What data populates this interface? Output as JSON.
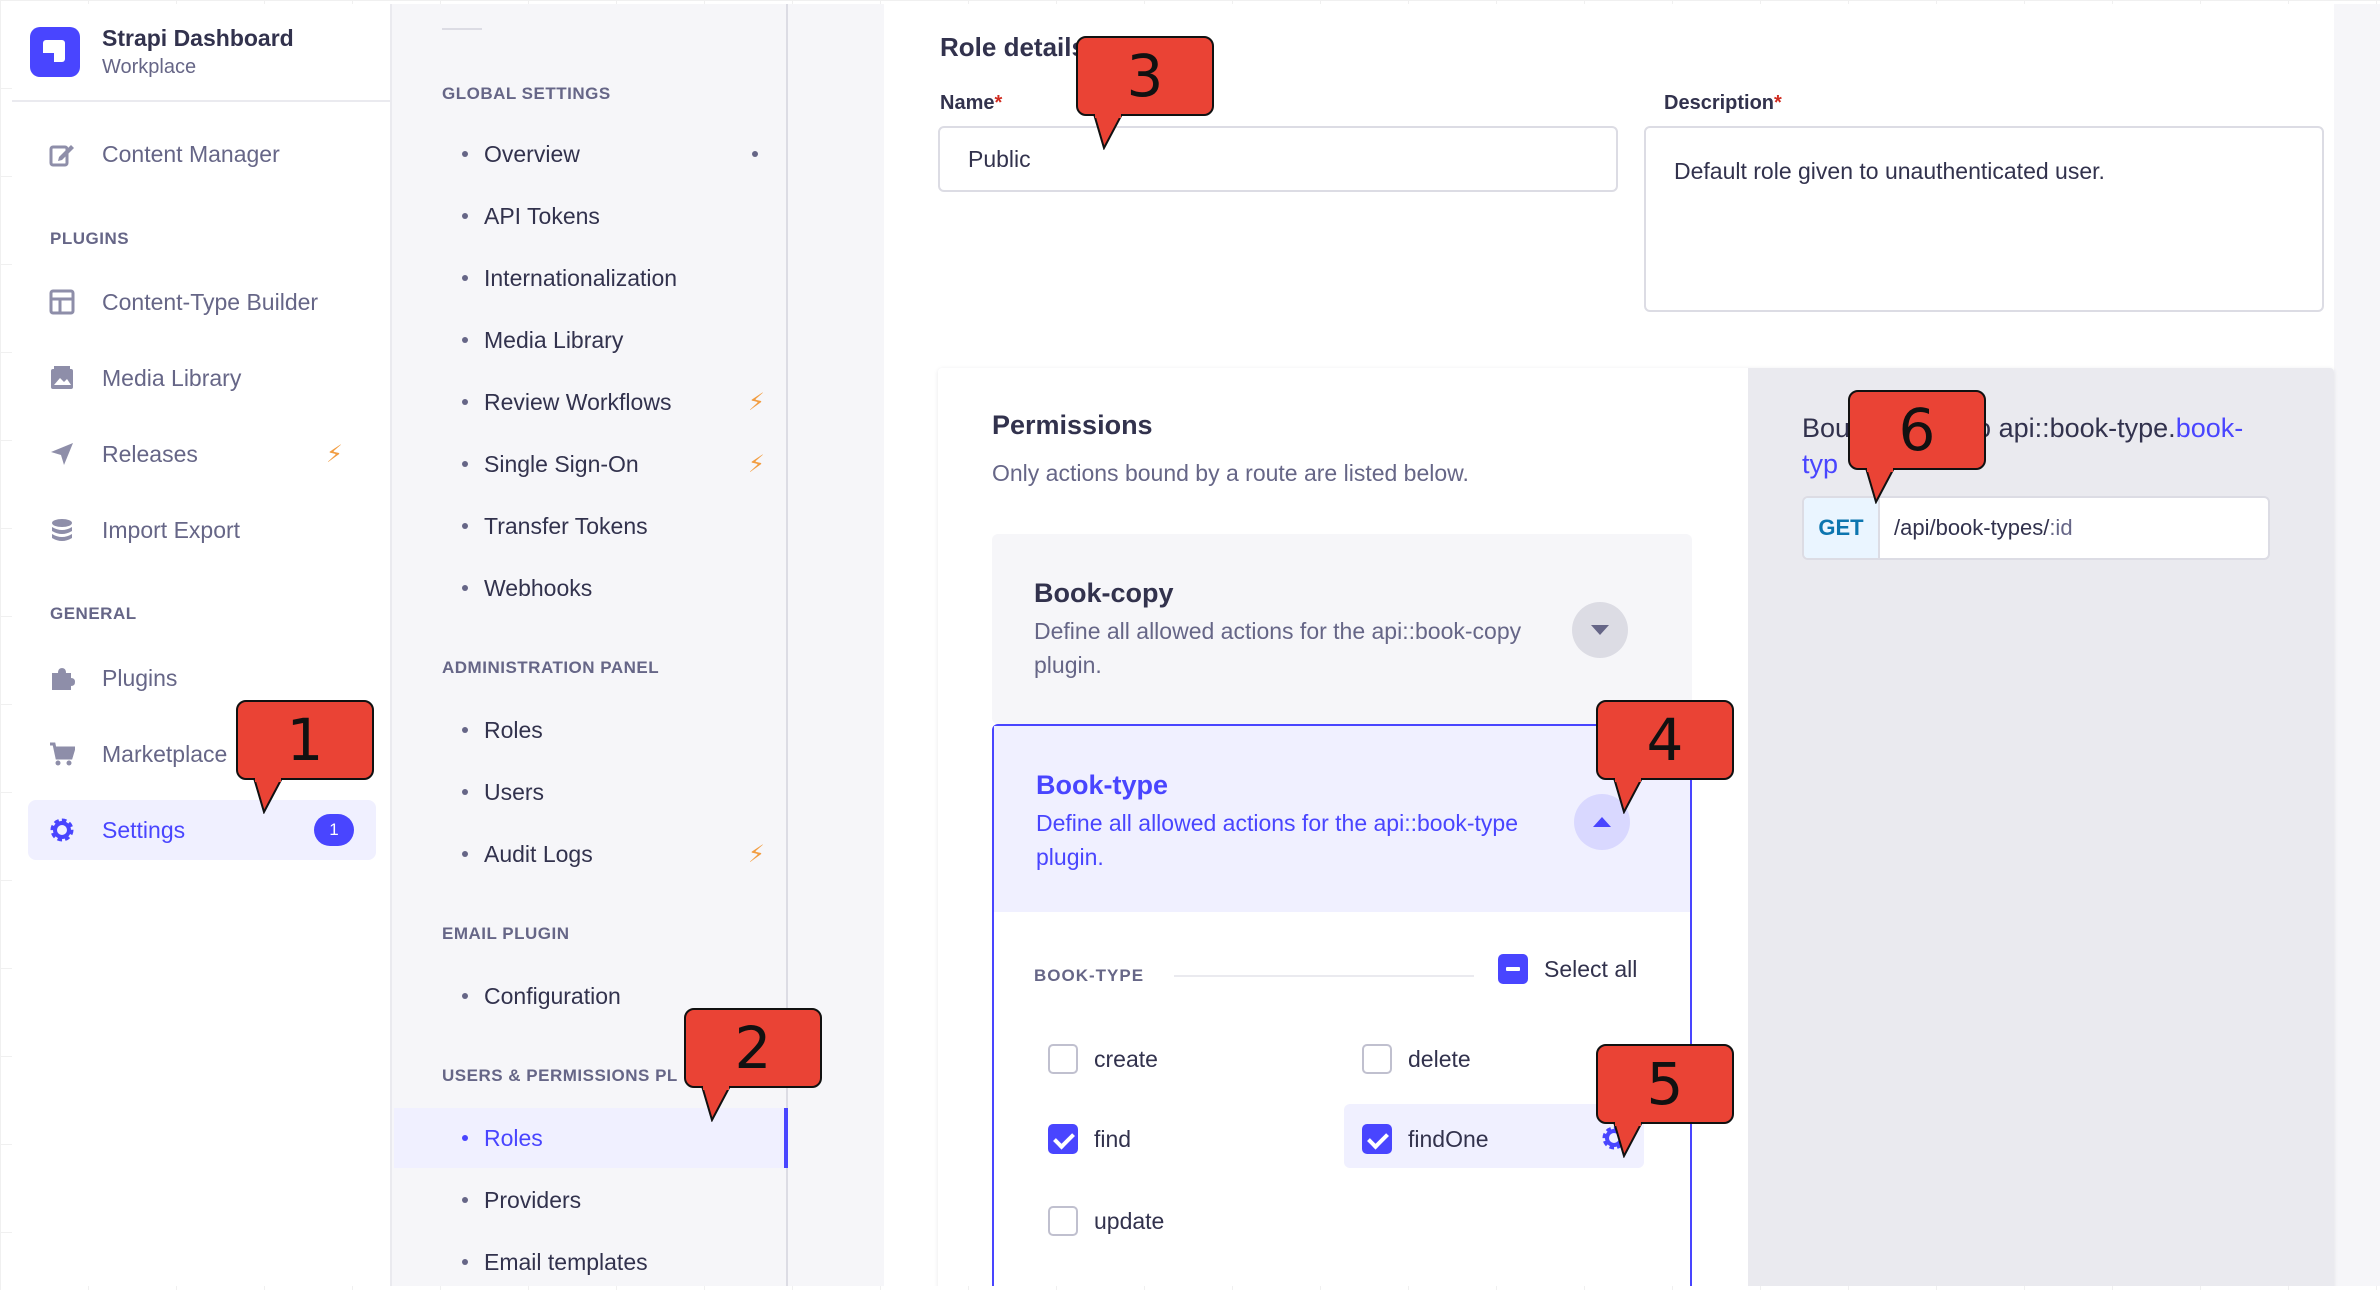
{
  "brand": {
    "title": "Strapi Dashboard",
    "subtitle": "Workplace"
  },
  "mainnav": {
    "content_manager": "Content Manager",
    "plugins_section": "PLUGINS",
    "plugins_items": [
      "Content-Type Builder",
      "Media Library",
      "Releases",
      "Import Export"
    ],
    "general_section": "GENERAL",
    "general_items": [
      "Plugins",
      "Marketplace",
      "Settings"
    ],
    "settings_badge": "1"
  },
  "subnav": {
    "global_section": "GLOBAL SETTINGS",
    "global_items": [
      "Overview",
      "API Tokens",
      "Internationalization",
      "Media Library",
      "Review Workflows",
      "Single Sign-On",
      "Transfer Tokens",
      "Webhooks"
    ],
    "admin_section": "ADMINISTRATION PANEL",
    "admin_items": [
      "Roles",
      "Users",
      "Audit Logs"
    ],
    "email_section": "EMAIL PLUGIN",
    "email_items": [
      "Configuration"
    ],
    "up_section": "USERS & PERMISSIONS PL",
    "up_items": [
      "Roles",
      "Providers",
      "Email templates"
    ]
  },
  "role": {
    "title": "Role details",
    "name_label": "Name",
    "name_value": "Public",
    "desc_label": "Description",
    "desc_value": "Default role given to unauthenticated user.",
    "required_mark": "*"
  },
  "permissions": {
    "title": "Permissions",
    "subtitle": "Only actions bound by a route are listed below.",
    "accordions": [
      {
        "name": "Book-copy",
        "desc": "Define all allowed actions for the api::book-copy plugin.",
        "expanded": false
      },
      {
        "name": "Book-type",
        "desc": "Define all allowed actions for the api::book-type plugin.",
        "expanded": true
      }
    ],
    "group_label": "BOOK-TYPE",
    "select_all": "Select all",
    "actions": [
      {
        "label": "create",
        "checked": false
      },
      {
        "label": "delete",
        "checked": false
      },
      {
        "label": "find",
        "checked": true
      },
      {
        "label": "findOne",
        "checked": true
      },
      {
        "label": "update",
        "checked": false
      }
    ]
  },
  "bound_route": {
    "text_prefix": "Bou",
    "text_middle": "o api::book-type.",
    "link_part1": "book-",
    "link_part2": "typ",
    "method": "GET",
    "path_prefix": "/api/book-types/",
    "path_param": ":id"
  },
  "callouts": [
    "1",
    "2",
    "3",
    "4",
    "5",
    "6"
  ],
  "colors": {
    "primary": "#4945ff",
    "callout": "#ea4335",
    "warning_bolt": "#f29d41",
    "route_get": "#0c75af"
  },
  "icons": [
    "pencil-icon",
    "layout-icon",
    "image-icon",
    "send-icon",
    "database-icon",
    "puzzle-icon",
    "cart-icon",
    "gear-icon",
    "bolt-icon",
    "chevron-down-icon",
    "chevron-up-icon"
  ]
}
